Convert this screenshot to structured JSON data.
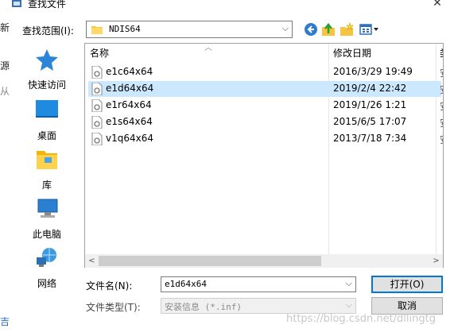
{
  "window": {
    "title": "查找文件",
    "close_symbol": "✕"
  },
  "ghost_left": [
    "新",
    "源",
    "从",
    "吉"
  ],
  "lookin": {
    "label": "查找范围(I):",
    "value": "NDIS64"
  },
  "toolbar": {
    "icons": [
      "back-icon",
      "up-folder-icon",
      "new-folder-icon",
      "view-menu-icon"
    ]
  },
  "places": [
    {
      "label": "快速访问",
      "icon": "quick-access-icon"
    },
    {
      "label": "桌面",
      "icon": "desktop-icon"
    },
    {
      "label": "库",
      "icon": "library-icon"
    },
    {
      "label": "此电脑",
      "icon": "this-pc-icon"
    },
    {
      "label": "网络",
      "icon": "network-icon"
    }
  ],
  "filelist": {
    "columns": {
      "name": "名称",
      "date": "修改日期",
      "type": "类"
    },
    "rows": [
      {
        "name": "e1c64x64",
        "date": "2016/3/29 19:49",
        "type": "安",
        "selected": false
      },
      {
        "name": "e1d64x64",
        "date": "2019/2/4 22:42",
        "type": "安",
        "selected": true
      },
      {
        "name": "e1r64x64",
        "date": "2019/1/26 1:21",
        "type": "安",
        "selected": false
      },
      {
        "name": "e1s64x64",
        "date": "2015/6/5 17:07",
        "type": "安",
        "selected": false
      },
      {
        "name": "v1q64x64",
        "date": "2013/7/18 7:34",
        "type": "安",
        "selected": false
      }
    ]
  },
  "filename": {
    "label": "文件名(N):",
    "value": "e1d64x64"
  },
  "filetype": {
    "label": "文件类型(T):",
    "value": "安装信息 (*.inf)"
  },
  "buttons": {
    "open": "打开(O)",
    "cancel": "取消"
  },
  "watermark": "https://blog.csdn.net/dllingtg"
}
